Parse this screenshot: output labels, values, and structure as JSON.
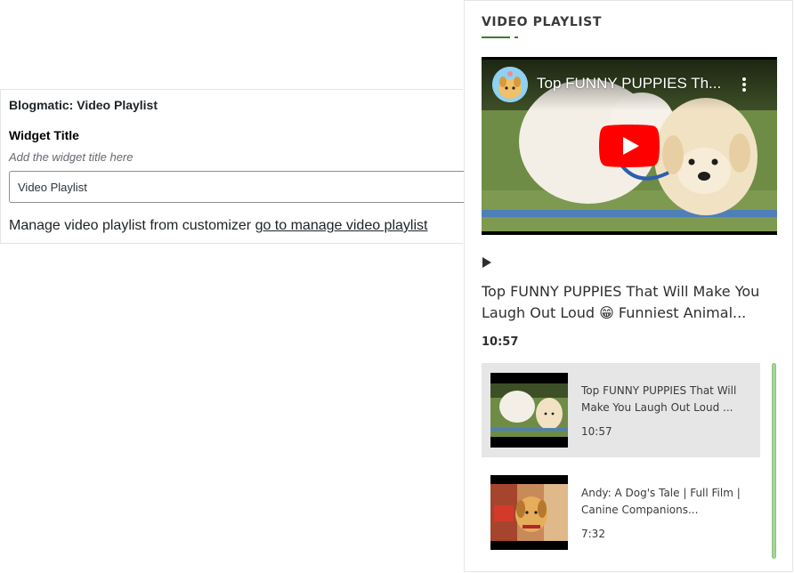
{
  "widget_form": {
    "widget_name": "Blogmatic: Video Playlist",
    "title_label": "Widget Title",
    "title_hint": "Add the widget title here",
    "title_value": "Video Playlist",
    "manage_text": "Manage video playlist from customizer",
    "manage_link": "go to manage video playlist"
  },
  "preview": {
    "heading": "VIDEO PLAYLIST",
    "accent_color": "#3a7d2c",
    "player": {
      "title": "Top FUNNY PUPPIES Th...",
      "play_button_color": "#ff0000",
      "menu_icon": "kebab-menu-icon"
    },
    "now_playing": {
      "icon": "play-icon",
      "title": "Top FUNNY PUPPIES That Will Make You Laugh Out Loud 😁 Funniest Animal...",
      "duration": "10:57"
    },
    "playlist": [
      {
        "title": "Top FUNNY PUPPIES That Will Make You Laugh Out Loud ...",
        "duration": "10:57",
        "active": true
      },
      {
        "title": "Andy: A Dog's Tale | Full Film | Canine Companions...",
        "duration": "7:32",
        "active": false
      }
    ]
  }
}
